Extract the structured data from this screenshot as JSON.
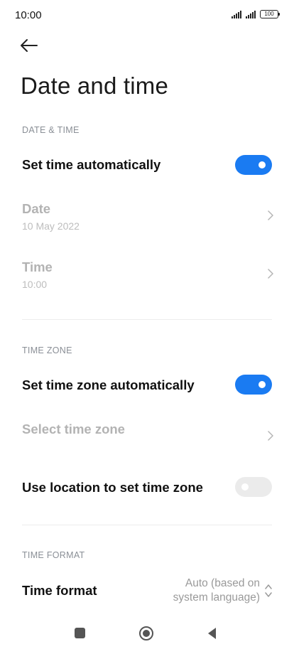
{
  "status": {
    "time": "10:00",
    "battery": "100"
  },
  "header": {
    "title": "Date and time"
  },
  "sections": {
    "date_time": "DATE & TIME",
    "time_zone": "TIME ZONE",
    "time_format": "TIME FORMAT"
  },
  "rows": {
    "set_time_auto": {
      "label": "Set time automatically",
      "enabled": true
    },
    "date": {
      "label": "Date",
      "value": "10 May 2022"
    },
    "time": {
      "label": "Time",
      "value": "10:00"
    },
    "set_zone_auto": {
      "label": "Set time zone automatically",
      "enabled": true
    },
    "select_zone": {
      "label": "Select time zone"
    },
    "use_location": {
      "label": "Use location to set time zone",
      "enabled": false
    },
    "time_format": {
      "label": "Time format",
      "value_line1": "Auto (based on",
      "value_line2": "system language)"
    }
  },
  "colors": {
    "accent": "#1a7bf2",
    "toggle_off": "#ebebeb",
    "disabled_text": "#b3b3b3",
    "section_header": "#8a8f96"
  }
}
